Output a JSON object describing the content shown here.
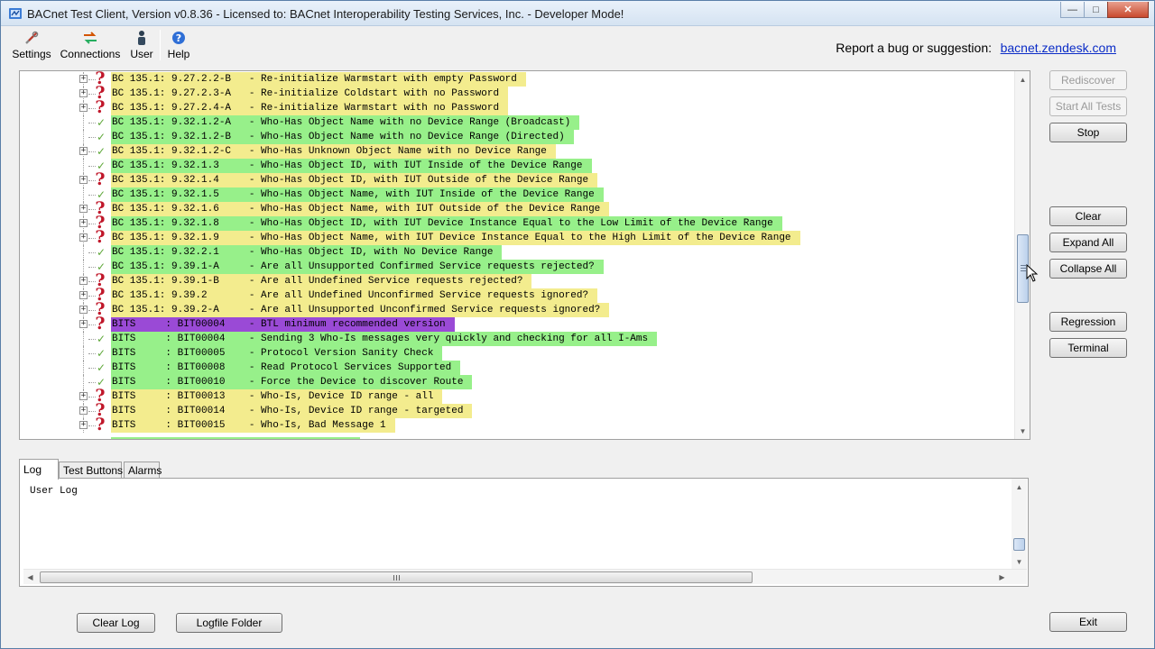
{
  "window": {
    "title": "BACnet Test Client, Version v0.8.36 - Licensed to: BACnet Interoperability Testing Services, Inc. - Developer Mode!",
    "minimize_icon": "minimize-icon",
    "maximize_icon": "maximize-icon",
    "close_icon": "close-icon"
  },
  "toolbar": {
    "settings": "Settings",
    "connections": "Connections",
    "user": "User",
    "help": "Help"
  },
  "report": {
    "label": "Report a bug or suggestion:",
    "link": "bacnet.zendesk.com"
  },
  "tests": [
    {
      "status": "question",
      "color": "yellow",
      "expandable": true,
      "label": "BC 135.1: 9.27.2.2-B   - Re-initialize Warmstart with empty Password"
    },
    {
      "status": "question",
      "color": "yellow",
      "expandable": true,
      "label": "BC 135.1: 9.27.2.3-A   - Re-initialize Coldstart with no Password"
    },
    {
      "status": "question",
      "color": "yellow",
      "expandable": true,
      "label": "BC 135.1: 9.27.2.4-A   - Re-initialize Warmstart with no Password"
    },
    {
      "status": "pass",
      "color": "green",
      "expandable": false,
      "label": "BC 135.1: 9.32.1.2-A   - Who-Has Object Name with no Device Range (Broadcast)"
    },
    {
      "status": "pass",
      "color": "green",
      "expandable": false,
      "label": "BC 135.1: 9.32.1.2-B   - Who-Has Object Name with no Device Range (Directed)"
    },
    {
      "status": "pass",
      "color": "yellow",
      "expandable": true,
      "label": "BC 135.1: 9.32.1.2-C   - Who-Has Unknown Object Name with no Device Range"
    },
    {
      "status": "pass",
      "color": "green",
      "expandable": false,
      "label": "BC 135.1: 9.32.1.3     - Who-Has Object ID, with IUT Inside of the Device Range"
    },
    {
      "status": "question",
      "color": "yellow",
      "expandable": true,
      "label": "BC 135.1: 9.32.1.4     - Who-Has Object ID, with IUT Outside of the Device Range"
    },
    {
      "status": "pass",
      "color": "green",
      "expandable": false,
      "label": "BC 135.1: 9.32.1.5     - Who-Has Object Name, with IUT Inside of the Device Range"
    },
    {
      "status": "question",
      "color": "yellow",
      "expandable": true,
      "label": "BC 135.1: 9.32.1.6     - Who-Has Object Name, with IUT Outside of the Device Range"
    },
    {
      "status": "question",
      "color": "green",
      "expandable": true,
      "label": "BC 135.1: 9.32.1.8     - Who-Has Object ID, with IUT Device Instance Equal to the Low Limit of the Device Range"
    },
    {
      "status": "question",
      "color": "yellow",
      "expandable": true,
      "label": "BC 135.1: 9.32.1.9     - Who-Has Object Name, with IUT Device Instance Equal to the High Limit of the Device Range"
    },
    {
      "status": "pass",
      "color": "green",
      "expandable": false,
      "label": "BC 135.1: 9.32.2.1     - Who-Has Object ID, with No Device Range"
    },
    {
      "status": "pass",
      "color": "green",
      "expandable": false,
      "label": "BC 135.1: 9.39.1-A     - Are all Unsupported Confirmed Service requests rejected?"
    },
    {
      "status": "question",
      "color": "yellow",
      "expandable": true,
      "label": "BC 135.1: 9.39.1-B     - Are all Undefined Service requests rejected?"
    },
    {
      "status": "question",
      "color": "yellow",
      "expandable": true,
      "label": "BC 135.1: 9.39.2       - Are all Undefined Unconfirmed Service requests ignored?"
    },
    {
      "status": "question",
      "color": "yellow",
      "expandable": true,
      "label": "BC 135.1: 9.39.2-A     - Are all Unsupported Unconfirmed Service requests ignored?"
    },
    {
      "status": "question",
      "color": "purple",
      "expandable": true,
      "label": "BITS     : BIT00004    - BTL minimum recommended version"
    },
    {
      "status": "pass",
      "color": "green",
      "expandable": false,
      "label": "BITS     : BIT00004    - Sending 3 Who-Is messages very quickly and checking for all I-Ams"
    },
    {
      "status": "pass",
      "color": "green",
      "expandable": false,
      "label": "BITS     : BIT00005    - Protocol Version Sanity Check"
    },
    {
      "status": "pass",
      "color": "green",
      "expandable": false,
      "label": "BITS     : BIT00008    - Read Protocol Services Supported"
    },
    {
      "status": "pass",
      "color": "green",
      "expandable": false,
      "label": "BITS     : BIT00010    - Force the Device to discover Route"
    },
    {
      "status": "question",
      "color": "yellow",
      "expandable": true,
      "label": "BITS     : BIT00013    - Who-Is, Device ID range - all"
    },
    {
      "status": "question",
      "color": "yellow",
      "expandable": true,
      "label": "BITS     : BIT00014    - Who-Is, Device ID range - targeted"
    },
    {
      "status": "question",
      "color": "yellow",
      "expandable": true,
      "label": "BITS     : BIT00015    - Who-Is, Bad Message 1"
    }
  ],
  "side_buttons": {
    "rediscover": "Rediscover",
    "start_all": "Start All Tests",
    "stop": "Stop",
    "clear": "Clear",
    "expand_all": "Expand All",
    "collapse_all": "Collapse All",
    "regression": "Regression",
    "terminal": "Terminal",
    "exit": "Exit"
  },
  "tabs": [
    "Log",
    "Test Buttons",
    "Alarms"
  ],
  "log": {
    "text": "User Log"
  },
  "bottom_buttons": {
    "clear_log": "Clear Log",
    "logfile_folder": "Logfile Folder"
  },
  "colors": {
    "yellow": "#f3ec8e",
    "green": "#97f08a",
    "purple": "#9a4ad6",
    "question": "#c0172a",
    "pass": "#5fa83a",
    "link": "#0b2cc7"
  }
}
